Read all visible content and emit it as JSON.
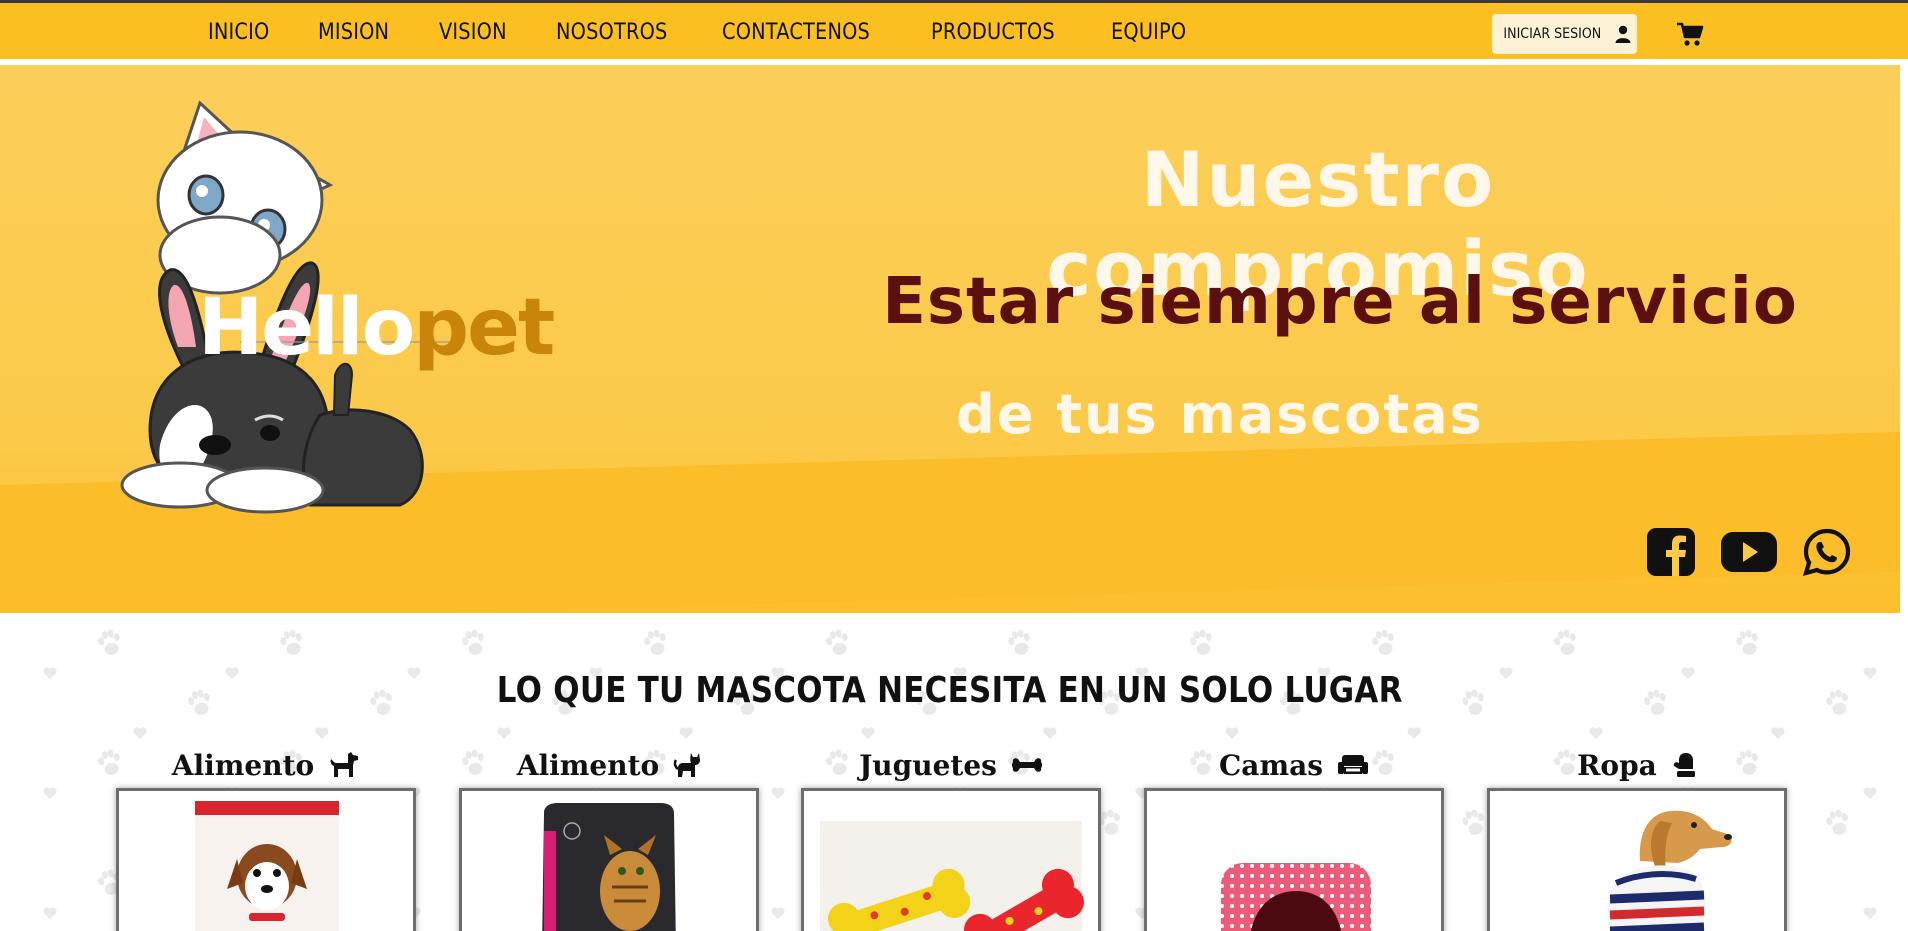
{
  "nav": {
    "items": [
      {
        "label": "INICIO"
      },
      {
        "label": "MISION"
      },
      {
        "label": "VISION"
      },
      {
        "label": "NOSOTROS"
      },
      {
        "label": "CONTACTENOS"
      },
      {
        "label": "PRODUCTOS"
      },
      {
        "label": "EQUIPO"
      }
    ],
    "login_label": "INICIAR SESION",
    "login_icon": "user-icon",
    "cart_icon": "shopping-cart-icon"
  },
  "hero": {
    "line1": "Nuestro compromiso",
    "line2": "Estar siempre al servicio",
    "line3": "de tus mascotas",
    "logo_part1": "Hello",
    "logo_part2": "pet",
    "socials": [
      {
        "icon": "facebook-icon"
      },
      {
        "icon": "youtube-icon"
      },
      {
        "icon": "whatsapp-icon"
      }
    ]
  },
  "section": {
    "title": "LO QUE TU MASCOTA NECESITA EN UN SOLO LUGAR"
  },
  "categories": [
    {
      "label": "Alimento",
      "icon": "dog-icon"
    },
    {
      "label": "Alimento",
      "icon": "cat-icon"
    },
    {
      "label": "Juguetes",
      "icon": "bone-icon"
    },
    {
      "label": "Camas",
      "icon": "couch-icon"
    },
    {
      "label": "Ropa",
      "icon": "mitten-icon"
    }
  ],
  "colors": {
    "navbar": "#fcbf22",
    "hero": "#fcc948",
    "hero_accent_text": "#5b0f0f"
  }
}
